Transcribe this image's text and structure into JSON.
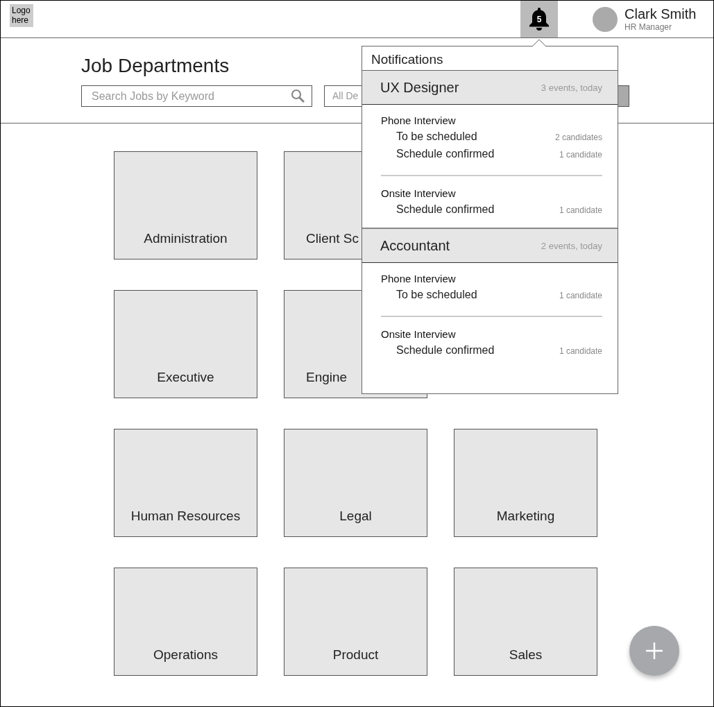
{
  "header": {
    "logo": "Logo here",
    "notification_count": "5",
    "user": {
      "name": "Clark Smith",
      "role": "HR Manager"
    }
  },
  "page": {
    "title": "Job Departments",
    "search": {
      "placeholder": "Search Jobs by Keyword"
    },
    "department_filter": {
      "value": "All De"
    }
  },
  "departments": [
    {
      "label": "Administration"
    },
    {
      "label": "Client Sc",
      "cut_off": true
    },
    {
      "label": "Executive"
    },
    {
      "label": "Engine",
      "cut_off": true
    },
    {
      "label": "Human Resources"
    },
    {
      "label": "Legal"
    },
    {
      "label": "Marketing"
    },
    {
      "label": "Operations"
    },
    {
      "label": "Product"
    },
    {
      "label": "Sales"
    }
  ],
  "notifications": {
    "title": "Notifications",
    "groups": [
      {
        "job": "UX Designer",
        "summary": "3 events, today",
        "sections": [
          {
            "title": "Phone Interview",
            "items": [
              {
                "status": "To be scheduled",
                "count": "2 candidates"
              },
              {
                "status": "Schedule confirmed",
                "count": "1 candidate"
              }
            ]
          },
          {
            "title": "Onsite Interview",
            "items": [
              {
                "status": "Schedule confirmed",
                "count": "1 candidate"
              }
            ]
          }
        ]
      },
      {
        "job": "Accountant",
        "summary": "2 events, today",
        "sections": [
          {
            "title": "Phone Interview",
            "items": [
              {
                "status": "To be scheduled",
                "count": "1 candidate"
              }
            ]
          },
          {
            "title": "Onsite Interview",
            "items": [
              {
                "status": "Schedule confirmed",
                "count": "1 candidate"
              }
            ]
          }
        ]
      }
    ]
  }
}
